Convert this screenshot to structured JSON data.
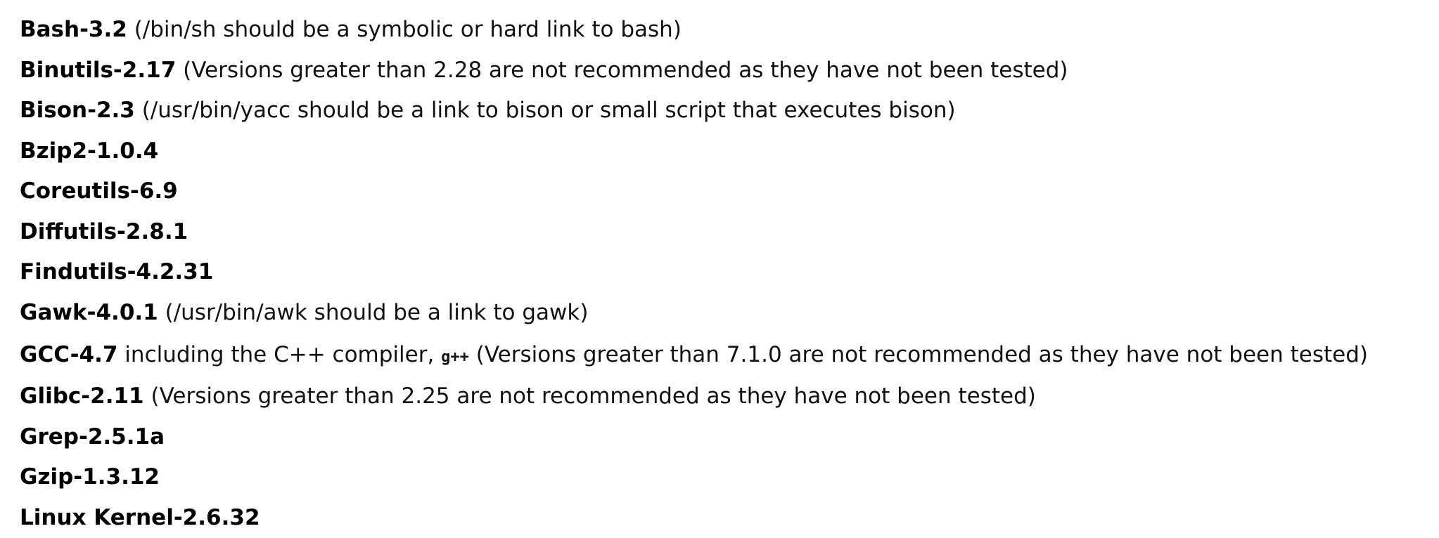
{
  "requirements": [
    {
      "name": "Bash-3.2",
      "note": " (/bin/sh should be a symbolic or hard link to bash)"
    },
    {
      "name": "Binutils-2.17",
      "note": " (Versions greater than 2.28 are not recommended as they have not been tested)"
    },
    {
      "name": "Bison-2.3",
      "note": " (/usr/bin/yacc should be a link to bison or small script that executes bison)"
    },
    {
      "name": "Bzip2-1.0.4",
      "note": ""
    },
    {
      "name": "Coreutils-6.9",
      "note": ""
    },
    {
      "name": "Diffutils-2.8.1",
      "note": ""
    },
    {
      "name": "Findutils-4.2.31",
      "note": ""
    },
    {
      "name": "Gawk-4.0.1",
      "note": " (/usr/bin/awk should be a link to gawk)"
    },
    {
      "name": "GCC-4.7",
      "note_before": " including the C++ compiler, ",
      "code": "g++",
      "note_after": " (Versions greater than 7.1.0 are not recommended as they have not been tested)"
    },
    {
      "name": "Glibc-2.11",
      "note": " (Versions greater than 2.25 are not recommended as they have not been tested)"
    },
    {
      "name": "Grep-2.5.1a",
      "note": ""
    },
    {
      "name": "Gzip-1.3.12",
      "note": ""
    },
    {
      "name": "Linux Kernel-2.6.32",
      "note": ""
    }
  ]
}
